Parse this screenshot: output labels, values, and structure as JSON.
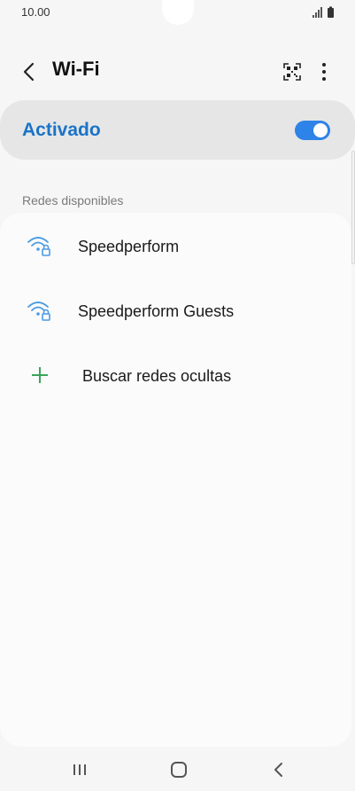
{
  "status_bar": {
    "time": "10.00"
  },
  "header": {
    "title": "Wi-Fi"
  },
  "master_switch": {
    "label": "Activado",
    "state": "on"
  },
  "section": {
    "title": "Redes disponibles"
  },
  "networks": [
    {
      "ssid": "Speedperform",
      "secured": true
    },
    {
      "ssid": "Speedperform Guests",
      "secured": true
    }
  ],
  "actions": {
    "hidden_networks": "Buscar redes ocultas"
  },
  "colors": {
    "accent": "#1a73c8",
    "toggle": "#2e83e8",
    "wifi_icon": "#4a9be3",
    "add_icon": "#3aa55a"
  }
}
